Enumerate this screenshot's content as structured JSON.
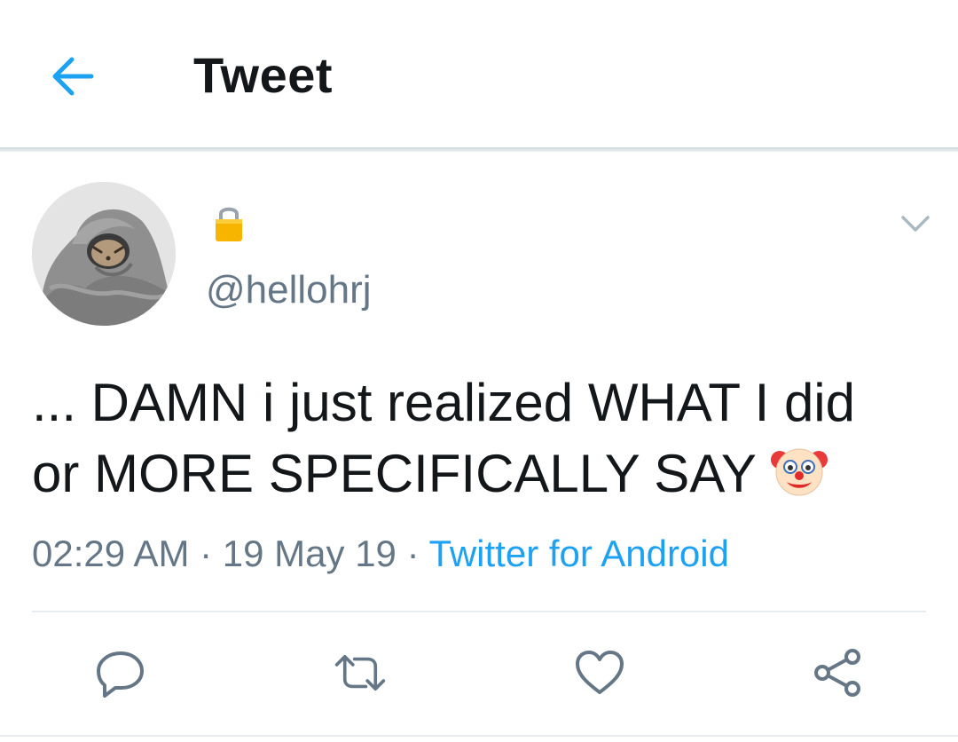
{
  "header": {
    "title": "Tweet",
    "back_icon": "arrow-left-icon"
  },
  "tweet": {
    "avatar_icon": "avatar",
    "protected_icon": "lock-icon",
    "handle": "@hellohrj",
    "menu_icon": "chevron-down-icon",
    "text_line1": "... DAMN i just realized WHAT I did",
    "text_line2": "or MORE SPECIFICALLY SAY",
    "emoji": "clown-face-icon",
    "time": "02:29 AM",
    "separator": " · ",
    "date": "19 May 19",
    "source": "Twitter for Android"
  },
  "actions": {
    "reply_icon": "reply-icon",
    "retweet_icon": "retweet-icon",
    "like_icon": "heart-icon",
    "share_icon": "share-icon"
  },
  "colors": {
    "accent": "#1da1f2",
    "text": "#14171a",
    "secondary": "#657786",
    "icon_gray": "#657786",
    "divider": "#e6ecf0"
  }
}
